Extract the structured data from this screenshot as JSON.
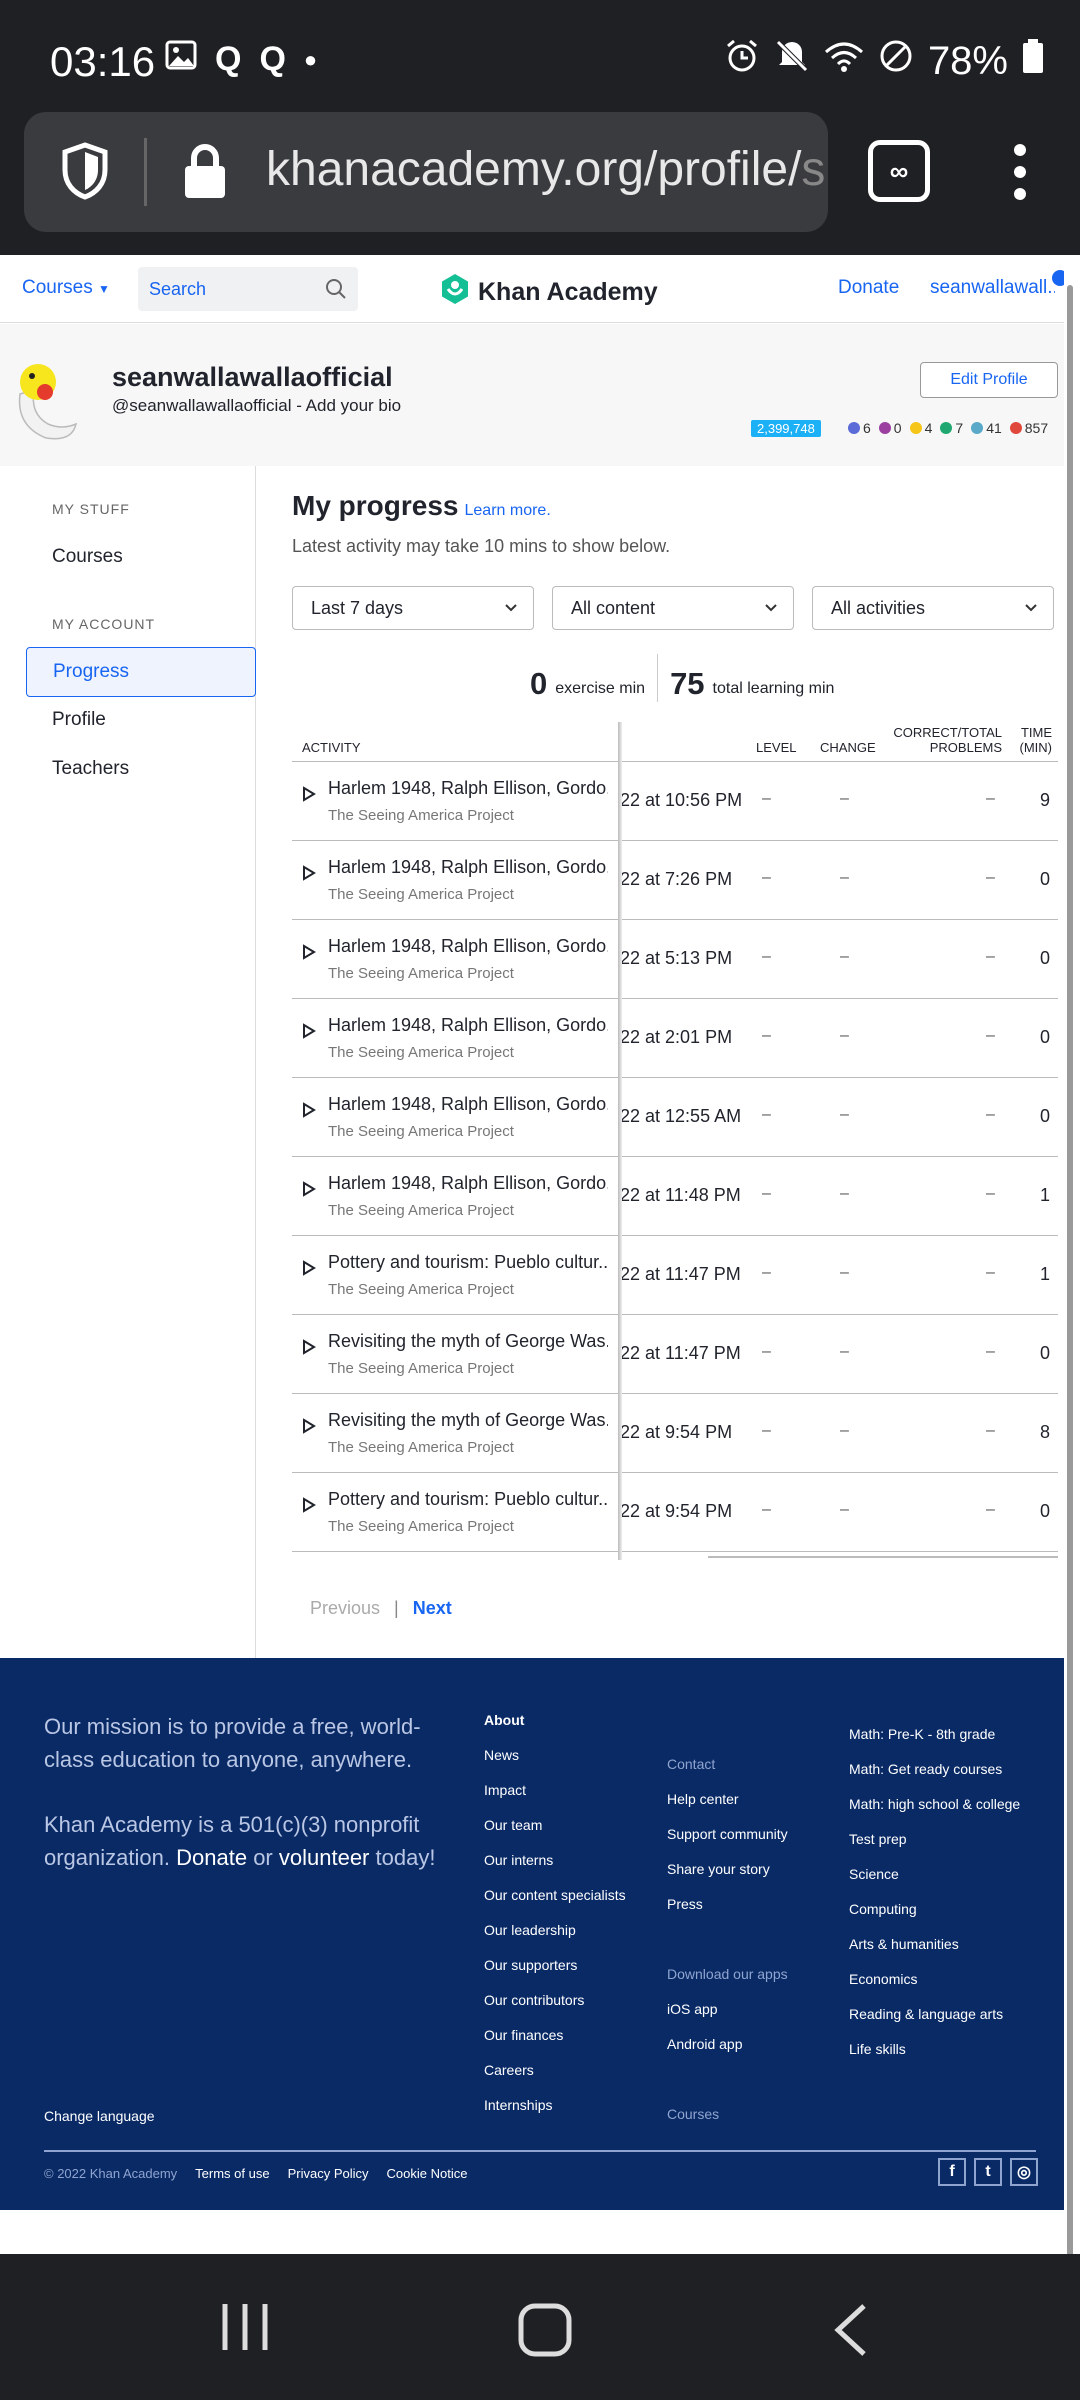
{
  "status_bar": {
    "time": "03:16",
    "battery": "78%",
    "left_icons": [
      "image-icon",
      "q-icon",
      "q-icon",
      "dot-icon"
    ],
    "right_icons": [
      "alarm-icon",
      "mute-icon",
      "wifi-icon",
      "block-icon",
      "battery-icon"
    ]
  },
  "browser": {
    "url_main": "khanacademy.org/profile/",
    "url_fade": "se"
  },
  "header": {
    "courses_label": "Courses",
    "search_placeholder": "Search",
    "brand": "Khan Academy",
    "donate": "Donate",
    "user": "seanwallawall..."
  },
  "profile": {
    "name": "seanwallawallaofficial",
    "handle": "@seanwallawallaofficial - Add your bio",
    "edit_label": "Edit Profile",
    "points": "2,399,748",
    "badges": [
      {
        "count": "6",
        "color": "#5b6bd8"
      },
      {
        "count": "0",
        "color": "#9b3fa1"
      },
      {
        "count": "4",
        "color": "#f5c518"
      },
      {
        "count": "7",
        "color": "#21a870"
      },
      {
        "count": "41",
        "color": "#5aa9c8"
      },
      {
        "count": "857",
        "color": "#e0483b"
      }
    ]
  },
  "sidebar": {
    "my_stuff": "MY STUFF",
    "courses": "Courses",
    "my_account": "MY ACCOUNT",
    "progress": "Progress",
    "profile": "Profile",
    "teachers": "Teachers"
  },
  "main": {
    "title": "My progress",
    "learn_more": "Learn more.",
    "subtitle": "Latest activity may take 10 mins to show below.",
    "filter_time": "Last 7 days",
    "filter_content": "All content",
    "filter_activity": "All activities",
    "exercise_value": "0",
    "exercise_label": "exercise min",
    "total_value": "75",
    "total_label": "total learning min",
    "columns": {
      "activity": "ACTIVITY",
      "level": "LEVEL",
      "change": "CHANGE",
      "correct_1": "CORRECT/TOTAL",
      "correct_2": "PROBLEMS",
      "time_1": "TIME",
      "time_2": "(MIN)"
    },
    "rows": [
      {
        "name": "Harlem 1948, Ralph Ellison, Gordo...",
        "project": "The Seeing America Project",
        "date": "22 at 10:56 PM",
        "level": "–",
        "change": "–",
        "correct": "–",
        "time": "9"
      },
      {
        "name": "Harlem 1948, Ralph Ellison, Gordo...",
        "project": "The Seeing America Project",
        "date": "22 at 7:26 PM",
        "level": "–",
        "change": "–",
        "correct": "–",
        "time": "0"
      },
      {
        "name": "Harlem 1948, Ralph Ellison, Gordo...",
        "project": "The Seeing America Project",
        "date": "22 at 5:13 PM",
        "level": "–",
        "change": "–",
        "correct": "–",
        "time": "0"
      },
      {
        "name": "Harlem 1948, Ralph Ellison, Gordo...",
        "project": "The Seeing America Project",
        "date": "22 at 2:01 PM",
        "level": "–",
        "change": "–",
        "correct": "–",
        "time": "0"
      },
      {
        "name": "Harlem 1948, Ralph Ellison, Gordo...",
        "project": "The Seeing America Project",
        "date": "22 at 12:55 AM",
        "level": "–",
        "change": "–",
        "correct": "–",
        "time": "0"
      },
      {
        "name": "Harlem 1948, Ralph Ellison, Gordo...",
        "project": "The Seeing America Project",
        "date": "22 at 11:48 PM",
        "level": "–",
        "change": "–",
        "correct": "–",
        "time": "1"
      },
      {
        "name": "Pottery and tourism: Pueblo cultur...",
        "project": "The Seeing America Project",
        "date": "22 at 11:47 PM",
        "level": "–",
        "change": "–",
        "correct": "–",
        "time": "1"
      },
      {
        "name": "Revisiting the myth of George Was...",
        "project": "The Seeing America Project",
        "date": "22 at 11:47 PM",
        "level": "–",
        "change": "–",
        "correct": "–",
        "time": "0"
      },
      {
        "name": "Revisiting the myth of George Was...",
        "project": "The Seeing America Project",
        "date": "22 at 9:54 PM",
        "level": "–",
        "change": "–",
        "correct": "–",
        "time": "8"
      },
      {
        "name": "Pottery and tourism: Pueblo cultur...",
        "project": "The Seeing America Project",
        "date": "22 at 9:54 PM",
        "level": "–",
        "change": "–",
        "correct": "–",
        "time": "0"
      }
    ],
    "previous": "Previous",
    "next": "Next"
  },
  "footer": {
    "mission": "Our mission is to provide a free, world-class education to anyone, anywhere.",
    "nonprofit_pre": "Khan Academy is a 501(c)(3) nonprofit organization.",
    "donate": "Donate",
    "or": "or",
    "volunteer": "volunteer",
    "today": "today!",
    "about": [
      "About",
      "News",
      "Impact",
      "Our team",
      "Our interns",
      "Our content specialists",
      "Our leadership",
      "Our supporters",
      "Our contributors",
      "Our finances",
      "Careers",
      "Internships"
    ],
    "contact": [
      "Contact",
      "Help center",
      "Support community",
      "Share your story",
      "Press"
    ],
    "apps": [
      "Download our apps",
      "iOS app",
      "Android app"
    ],
    "courses_head": "Courses",
    "subjects": [
      "Math: Pre-K - 8th grade",
      "Math: Get ready courses",
      "Math: high school & college",
      "Test prep",
      "Science",
      "Computing",
      "Arts & humanities",
      "Economics",
      "Reading & language arts",
      "Life skills"
    ],
    "change_language": "Change language",
    "copyright": "© 2022 Khan Academy",
    "terms": "Terms of use",
    "privacy": "Privacy Policy",
    "cookie": "Cookie Notice",
    "social": [
      "facebook-icon",
      "twitter-icon",
      "instagram-icon"
    ]
  }
}
